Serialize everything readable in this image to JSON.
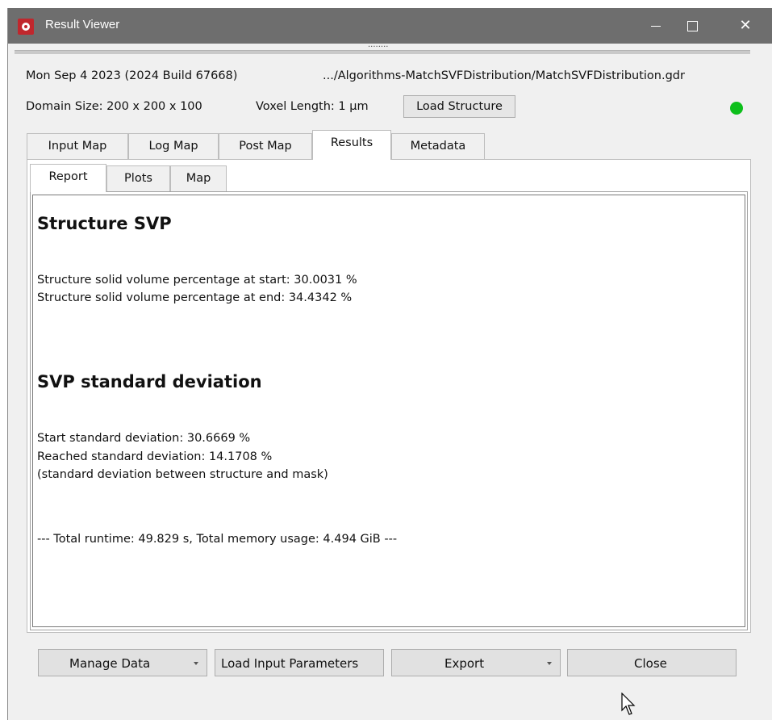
{
  "window": {
    "title": "Result Viewer"
  },
  "header": {
    "date_build": "Mon Sep 4 2023 (2024 Build 67668)",
    "file_path": ".../Algorithms-MatchSVFDistribution/MatchSVFDistribution.gdr",
    "domain_size": "Domain Size: 200 x 200 x 100",
    "voxel_length": "Voxel Length: 1 µm",
    "load_structure_label": "Load Structure",
    "status_color": "#0dbf1b"
  },
  "tabs": [
    {
      "label": "Input Map"
    },
    {
      "label": "Log Map"
    },
    {
      "label": "Post Map"
    },
    {
      "label": "Results",
      "active": true
    },
    {
      "label": "Metadata"
    }
  ],
  "subtabs": [
    {
      "label": "Report",
      "active": true
    },
    {
      "label": "Plots"
    },
    {
      "label": "Map"
    }
  ],
  "report": {
    "heading1": "Structure SVP",
    "svp_start": "Structure solid volume percentage at start: 30.0031 %",
    "svp_end": "Structure solid volume percentage at end: 34.4342 %",
    "heading2": "SVP standard deviation",
    "std_start": "Start standard deviation: 30.6669 %",
    "std_reached": "Reached standard deviation: 14.1708 %",
    "std_note": "(standard deviation between structure and mask)",
    "runtime": "--- Total runtime: 49.829 s, Total memory usage: 4.494 GiB ---"
  },
  "buttons": {
    "manage_data": "Manage Data",
    "load_input_parameters": "Load Input Parameters",
    "export": "Export",
    "close": "Close"
  }
}
